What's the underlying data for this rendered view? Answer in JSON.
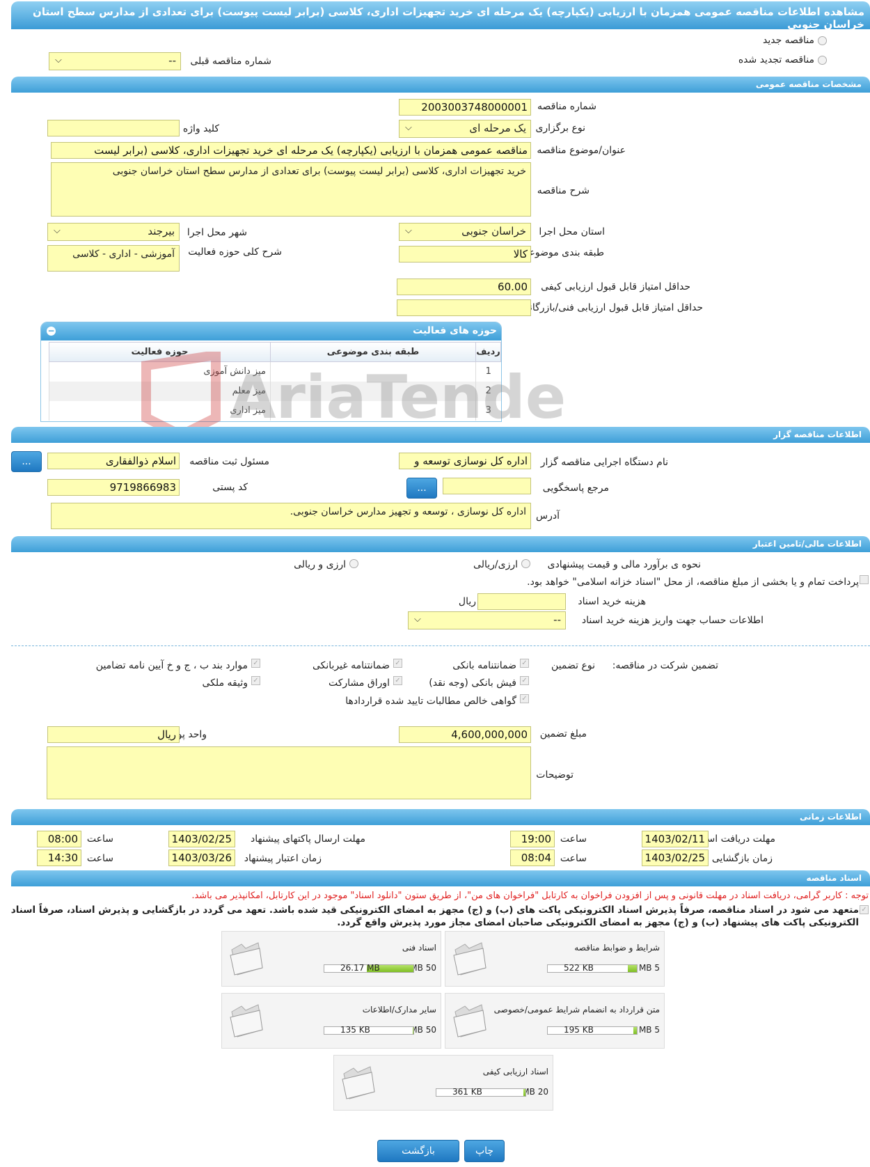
{
  "header": {
    "title": "مشاهده اطلاعات مناقصه عمومی همزمان با ارزیابی (یکپارچه) یک مرحله ای خرید تجهیزات اداری، کلاسی (برابر لیست پیوست) برای تعدادی از مدارس سطح استان خراسان جنوبی"
  },
  "top": {
    "new_tender": "مناقصه جدید",
    "renewed_tender": "مناقصه تجدید شده",
    "prev_number_label": "شماره مناقصه قبلی",
    "prev_number_value": "--"
  },
  "general": {
    "section_title": "مشخصات مناقصه عمومی",
    "number_label": "شماره مناقصه",
    "number_value": "2003003748000001",
    "type_label": "نوع برگزاری",
    "type_value": "یک مرحله ای",
    "keyword_label": "کلید واژه",
    "keyword_value": "",
    "title_label": "عنوان/موضوع مناقصه",
    "title_value": "مناقصه عمومی همزمان با ارزیابی (یکپارچه) یک مرحله ای خرید  تجهیزات اداری، کلاسی (برابر لیست",
    "desc_label": "شرح مناقصه",
    "desc_value": "خرید  تجهیزات اداری، کلاسی (برابر لیست پیوست)   برای تعدادی از مدارس سطح استان خراسان جنوبی",
    "province_label": "استان محل اجرا",
    "province_value": "خراسان جنوبی",
    "city_label": "شهر محل اجرا",
    "city_value": "بیرجند",
    "category_label": "طبقه بندی موضوعی",
    "category_value": "کالا",
    "scope_label": "شرح کلی حوزه فعالیت",
    "scope_value": "آموزشی - اداری  - کلاسی",
    "min_quality_label": "حداقل امتیاز قابل قبول ارزیابی کیفی",
    "min_quality_value": "60.00",
    "min_tech_label": "حداقل امتیاز قابل قبول ارزیابی فنی/بازرگانی",
    "min_tech_value": ""
  },
  "activity": {
    "title": "حوزه های فعالیت",
    "col_row": "ردیف",
    "col_cat": "طبقه بندی موضوعی",
    "col_field": "حوزه فعالیت",
    "rows": [
      {
        "n": "1",
        "cat": "",
        "field": "میز دانش آموزی"
      },
      {
        "n": "2",
        "cat": "",
        "field": "میز معلم"
      },
      {
        "n": "3",
        "cat": "",
        "field": "میز اداری"
      }
    ]
  },
  "watermark": "AriaTender.neT",
  "org": {
    "section_title": "اطلاعات مناقصه گزار",
    "org_label": "نام دستگاه اجرایی مناقصه گزار",
    "org_value": "اداره کل نوسازی  توسعه و",
    "registrar_label": "مسئول ثبت مناقصه",
    "registrar_value": "اسلام ذوالفقاری",
    "ref_label": "مرجع پاسخگویی",
    "ref_value": "",
    "postal_label": "کد پستی",
    "postal_value": "9719866983",
    "address_label": "آدرس",
    "address_value": "اداره کل نوسازی ، توسعه و تجهیز مدارس خراسان جنوبی.",
    "more": "..."
  },
  "finance": {
    "section_title": "اطلاعات مالی/تامین اعتبار",
    "method_label": "نحوه ی برآورد مالی و قیمت پیشنهادی",
    "opt_rial": "ارزی/ریالی",
    "opt_fx": "ارزی و ریالی",
    "treasury_text": "پرداخت تمام و یا بخشی از مبلغ مناقصه، از محل \"اسناد خزانه اسلامی\" خواهد بود.",
    "doc_cost_label": "هزینه خرید اسناد",
    "doc_cost_value": "",
    "doc_cost_unit": "ریال",
    "account_label": "اطلاعات حساب جهت واریز هزینه خرید اسناد",
    "account_value": "--"
  },
  "guarantee": {
    "label": "تضمین شرکت در مناقصه:",
    "type_label": "نوع تضمین",
    "bank": "ضمانتنامه بانکی",
    "nonbank": "ضمانتنامه غیربانکی",
    "clauses": "موارد بند ب ، ج و خ آیین نامه تضامین",
    "cash": "فیش بانکی (وجه نقد)",
    "bonds": "اوراق مشارکت",
    "property": "وثیقه ملکی",
    "receivables": "گواهی خالص مطالبات تایید شده قراردادها",
    "amount_label": "مبلغ تضمین",
    "amount_value": "4,600,000,000",
    "currency_label": "واحد پول",
    "currency_value": "ریال",
    "notes_label": "توضیحات",
    "notes_value": ""
  },
  "timing": {
    "section_title": "اطلاعات زمانی",
    "receive_label": "مهلت دریافت اسناد",
    "receive_date": "1403/02/11",
    "receive_time": "19:00",
    "send_label": "مهلت ارسال پاکتهای پیشنهاد",
    "send_date": "1403/02/25",
    "send_time": "08:00",
    "open_label": "زمان بازگشایی پاکت ها",
    "open_date": "1403/02/25",
    "open_time": "08:04",
    "valid_label": "زمان اعتبار پیشنهاد",
    "valid_date": "1403/03/26",
    "valid_time": "14:30",
    "time_label": "ساعت"
  },
  "docs": {
    "section_title": "اسناد مناقصه",
    "notice": "توجه : کاربر گرامی، دریافت اسناد در مهلت قانونی و پس از افزودن فراخوان به کارتابل \"فراخوان های من\"، از طریق ستون \"دانلود اسناد\" موجود در این کارتابل، امکانپذیر می باشد.",
    "commit": "متعهد می شود در اسناد مناقصه، صرفاً پذیرش اسناد الکترونیکی پاکت های (ب) و (ج) مجهز به امضای الکترونیکی قید شده باشد. تعهد می گردد در بازگشایی و پذیرش اسناد، صرفاً اسناد الکترونیکی پاکت های پیشنهاد (ب) و (ج) مجهز به امضای الکترونیکی صاحبان امضای مجاز مورد پذیرش واقع گردد.",
    "files": [
      {
        "title": "شرایط و ضوابط مناقصه",
        "size": "522 KB",
        "max": "5 MB",
        "fill": 0.1
      },
      {
        "title": "اسناد فنی",
        "size": "26.17 MB",
        "max": "50 MB",
        "fill": 0.52
      },
      {
        "title": "متن قرارداد به انضمام شرایط عمومی/خصوصی",
        "size": "195 KB",
        "max": "5 MB",
        "fill": 0.04
      },
      {
        "title": "سایر مدارک/اطلاعات",
        "size": "135 KB",
        "max": "50 MB",
        "fill": 0.01
      },
      {
        "title": "اسناد ارزیابی کیفی",
        "size": "361 KB",
        "max": "20 MB",
        "fill": 0.02
      }
    ]
  },
  "actions": {
    "print": "چاپ",
    "back": "بازگشت"
  }
}
